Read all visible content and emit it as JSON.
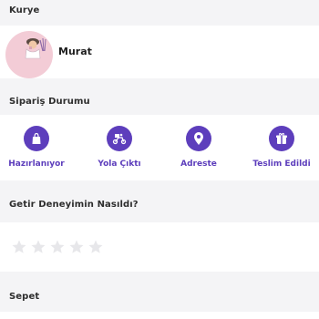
{
  "courier": {
    "section_title": "Kurye",
    "name": "Murat"
  },
  "order_status": {
    "section_title": "Sipariş Durumu",
    "steps": [
      {
        "label": "Hazırlanıyor",
        "icon": "shopping-bag-icon"
      },
      {
        "label": "Yola Çıktı",
        "icon": "scooter-icon"
      },
      {
        "label": "Adreste",
        "icon": "location-pin-icon"
      },
      {
        "label": "Teslim Edildi",
        "icon": "delivered-box-icon"
      }
    ],
    "accent_color": "#5d3ebc"
  },
  "rating": {
    "section_title": "Getir Deneyimin Nasıldı?",
    "max_stars": 5,
    "selected_stars": 0,
    "empty_star_color": "#e7e7ea"
  },
  "basket": {
    "section_title": "Sepet"
  }
}
